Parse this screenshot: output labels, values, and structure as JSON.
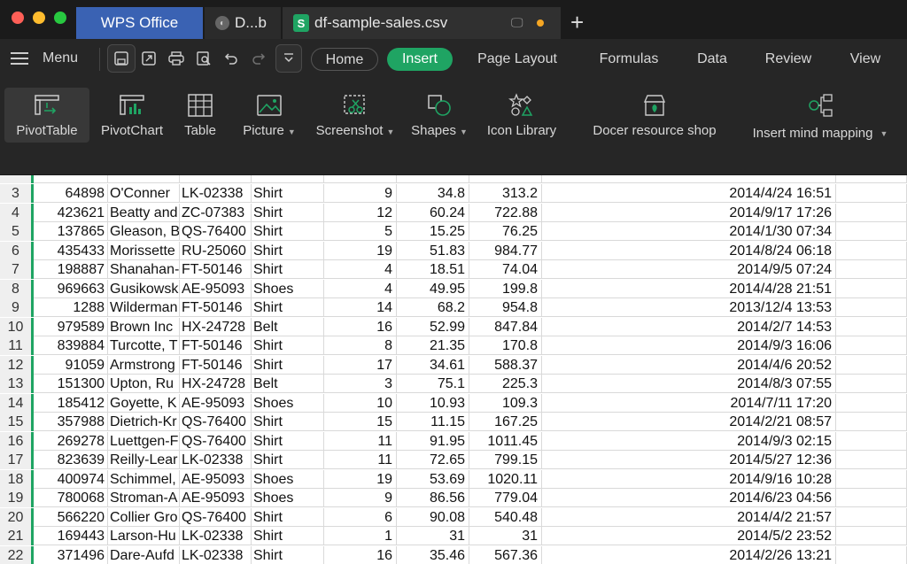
{
  "window": {
    "tabs": [
      {
        "label": "WPS Office"
      },
      {
        "label": "D...b"
      },
      {
        "label": "df-sample-sales.csv"
      }
    ],
    "new_tab": "+",
    "csv_icon": "S"
  },
  "toolbar": {
    "menu_label": "Menu",
    "menu_tabs": [
      "Home",
      "Insert",
      "Page Layout",
      "Formulas",
      "Data",
      "Review",
      "View"
    ],
    "active_tab": "Insert",
    "accent_color": "#1fa463"
  },
  "ribbon": {
    "buttons": [
      {
        "label": "PivotTable",
        "icon": "pivot-table-icon"
      },
      {
        "label": "PivotChart",
        "icon": "pivot-chart-icon"
      },
      {
        "label": "Table",
        "icon": "table-icon"
      },
      {
        "label": "Picture",
        "icon": "picture-icon",
        "dropdown": true
      },
      {
        "label": "Screenshot",
        "icon": "screenshot-icon",
        "dropdown": true
      },
      {
        "label": "Shapes",
        "icon": "shapes-icon",
        "dropdown": true
      },
      {
        "label": "Icon Library",
        "icon": "icon-library-icon"
      },
      {
        "label": "Docer resource shop",
        "icon": "shop-icon"
      },
      {
        "label": "Insert mind mapping",
        "icon": "mind-map-icon",
        "dropdown": true
      }
    ]
  },
  "sheet": {
    "rows": [
      {
        "n": "3",
        "id": "64898",
        "company": "O'Conner",
        "sku": "LK-02338",
        "category": "Shirt",
        "qty": "9",
        "price": "34.8",
        "total": "313.2",
        "date": "2014/4/24 16:51"
      },
      {
        "n": "4",
        "id": "423621",
        "company": "Beatty and",
        "sku": "ZC-07383",
        "category": "Shirt",
        "qty": "12",
        "price": "60.24",
        "total": "722.88",
        "date": "2014/9/17 17:26"
      },
      {
        "n": "5",
        "id": "137865",
        "company": "Gleason, B",
        "sku": "QS-76400",
        "category": "Shirt",
        "qty": "5",
        "price": "15.25",
        "total": "76.25",
        "date": "2014/1/30 07:34"
      },
      {
        "n": "6",
        "id": "435433",
        "company": "Morissette",
        "sku": "RU-25060",
        "category": "Shirt",
        "qty": "19",
        "price": "51.83",
        "total": "984.77",
        "date": "2014/8/24 06:18"
      },
      {
        "n": "7",
        "id": "198887",
        "company": "Shanahan-",
        "sku": "FT-50146",
        "category": "Shirt",
        "qty": "4",
        "price": "18.51",
        "total": "74.04",
        "date": "2014/9/5 07:24"
      },
      {
        "n": "8",
        "id": "969663",
        "company": "Gusikowsk",
        "sku": "AE-95093",
        "category": "Shoes",
        "qty": "4",
        "price": "49.95",
        "total": "199.8",
        "date": "2014/4/28 21:51"
      },
      {
        "n": "9",
        "id": "1288",
        "company": "Wilderman",
        "sku": "FT-50146",
        "category": "Shirt",
        "qty": "14",
        "price": "68.2",
        "total": "954.8",
        "date": "2013/12/4 13:53"
      },
      {
        "n": "10",
        "id": "979589",
        "company": "Brown Inc",
        "sku": "HX-24728",
        "category": "Belt",
        "qty": "16",
        "price": "52.99",
        "total": "847.84",
        "date": "2014/2/7 14:53"
      },
      {
        "n": "11",
        "id": "839884",
        "company": "Turcotte, T",
        "sku": "FT-50146",
        "category": "Shirt",
        "qty": "8",
        "price": "21.35",
        "total": "170.8",
        "date": "2014/9/3 16:06"
      },
      {
        "n": "12",
        "id": "91059",
        "company": "Armstrong",
        "sku": "FT-50146",
        "category": "Shirt",
        "qty": "17",
        "price": "34.61",
        "total": "588.37",
        "date": "2014/4/6 20:52"
      },
      {
        "n": "13",
        "id": "151300",
        "company": "Upton, Ru",
        "sku": "HX-24728",
        "category": "Belt",
        "qty": "3",
        "price": "75.1",
        "total": "225.3",
        "date": "2014/8/3 07:55"
      },
      {
        "n": "14",
        "id": "185412",
        "company": "Goyette, K",
        "sku": "AE-95093",
        "category": "Shoes",
        "qty": "10",
        "price": "10.93",
        "total": "109.3",
        "date": "2014/7/11 17:20"
      },
      {
        "n": "15",
        "id": "357988",
        "company": "Dietrich-Kr",
        "sku": "QS-76400",
        "category": "Shirt",
        "qty": "15",
        "price": "11.15",
        "total": "167.25",
        "date": "2014/2/21 08:57"
      },
      {
        "n": "16",
        "id": "269278",
        "company": "Luettgen-F",
        "sku": "QS-76400",
        "category": "Shirt",
        "qty": "11",
        "price": "91.95",
        "total": "1011.45",
        "date": "2014/9/3 02:15"
      },
      {
        "n": "17",
        "id": "823639",
        "company": "Reilly-Lear",
        "sku": "LK-02338",
        "category": "Shirt",
        "qty": "11",
        "price": "72.65",
        "total": "799.15",
        "date": "2014/5/27 12:36"
      },
      {
        "n": "18",
        "id": "400974",
        "company": "Schimmel,",
        "sku": "AE-95093",
        "category": "Shoes",
        "qty": "19",
        "price": "53.69",
        "total": "1020.11",
        "date": "2014/9/16 10:28"
      },
      {
        "n": "19",
        "id": "780068",
        "company": "Stroman-A",
        "sku": "AE-95093",
        "category": "Shoes",
        "qty": "9",
        "price": "86.56",
        "total": "779.04",
        "date": "2014/6/23 04:56"
      },
      {
        "n": "20",
        "id": "566220",
        "company": "Collier Gro",
        "sku": "QS-76400",
        "category": "Shirt",
        "qty": "6",
        "price": "90.08",
        "total": "540.48",
        "date": "2014/4/2 21:57"
      },
      {
        "n": "21",
        "id": "169443",
        "company": "Larson-Hu",
        "sku": "LK-02338",
        "category": "Shirt",
        "qty": "1",
        "price": "31",
        "total": "31",
        "date": "2014/5/2 23:52"
      },
      {
        "n": "22",
        "id": "371496",
        "company": "Dare-Aufd",
        "sku": "LK-02338",
        "category": "Shirt",
        "qty": "16",
        "price": "35.46",
        "total": "567.36",
        "date": "2014/2/26 13:21"
      }
    ]
  }
}
